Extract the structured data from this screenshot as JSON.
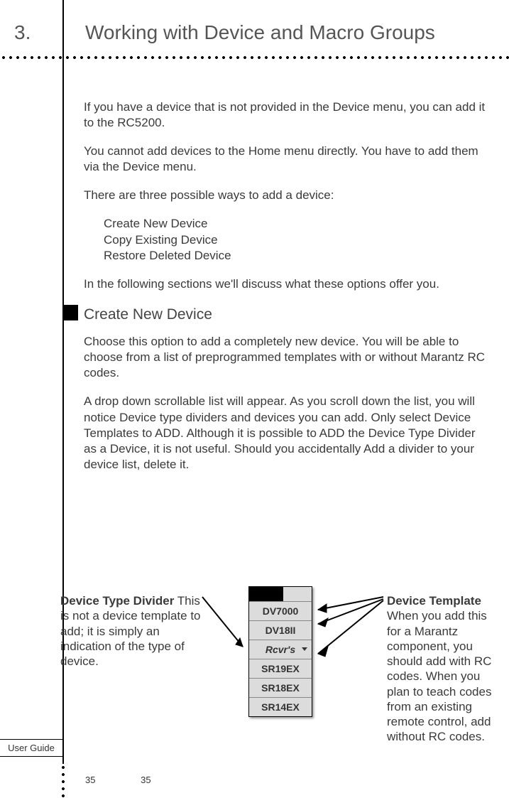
{
  "chapter": {
    "number": "3.",
    "title": "Working with Device and Macro Groups"
  },
  "para1": "If you have a device that is not provided in the Device menu, you can add it to the RC5200.",
  "para2": "You cannot add devices to the Home menu directly. You have to add them via the Device menu.",
  "para3": "There are three possible ways to add a device:",
  "options": {
    "a": "Create New Device",
    "b": "Copy Existing Device",
    "c": "Restore Deleted Device"
  },
  "para4": "In the following sections we'll discuss what these options offer you.",
  "section_heading": "Create New Device",
  "para5": "Choose this option to add a completely new device. You will be able to choose from a list of preprogrammed templates with or without Marantz RC codes.",
  "para6": "A drop down scrollable list will appear. As you scroll down the list, you will notice Device type dividers and devices you can add. Only select Device Templates to ADD. Although it is possible to ADD the Device Type Divider as a Device, it is not useful. Should you accidentally Add a divider to your device list, delete it.",
  "callout_left": {
    "heading": "Device Type Divider",
    "body": "This is not a device template to add; it is simply an indication of the type of device."
  },
  "callout_right": {
    "heading": "Device Template",
    "body": "When you add this for a Marantz component, you should add with RC codes. When you plan to teach codes from an existing remote control, add without RC codes."
  },
  "device_list": {
    "items": [
      "DV7000",
      "DV18II",
      "Rcvr's",
      "SR19EX",
      "SR18EX",
      "SR14EX"
    ]
  },
  "footer": {
    "user_guide": "User Guide",
    "page_a": "35",
    "page_b": "35"
  }
}
